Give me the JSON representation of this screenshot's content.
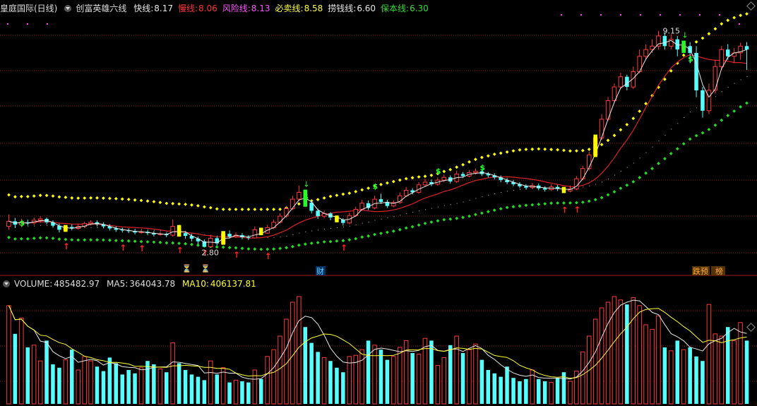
{
  "header": {
    "stock": "皇庭国际(日线)",
    "indicator_name": "创富英雄六线",
    "lines": [
      {
        "label": "快线:",
        "value": "8.17",
        "color": "#e8e8e8"
      },
      {
        "label": "慢线:",
        "value": "8.06",
        "color": "#ff3333"
      },
      {
        "label": "风险线:",
        "value": "8.13",
        "color": "#ff55ff"
      },
      {
        "label": "必卖线:",
        "value": "8.58",
        "color": "#ffff33"
      },
      {
        "label": "捞钱线:",
        "value": "6.60",
        "color": "#e8e8e8"
      },
      {
        "label": "保本线:",
        "value": "6.30",
        "color": "#33dd33"
      }
    ]
  },
  "volume_header": {
    "name": "VOLUME:",
    "value": "485482.97",
    "ma5_label": "MA5:",
    "ma5_value": "364043.78",
    "ma10_label": "MA10:",
    "ma10_value": "406137.81"
  },
  "annotations": {
    "high_label": "9.15",
    "low_label": "2.80",
    "cai_badge": "财",
    "tag1": "跌预",
    "tag2": "榜"
  },
  "colors": {
    "up": "#ff3a3a",
    "down": "#55ffff",
    "fast": "#e8e8e8",
    "slow": "#dd2222",
    "must_sell": "#ffff00",
    "keep": "#22dd22",
    "grid": "#8a1a1a",
    "ma5": "#e8e8e8",
    "ma10": "#ffff33",
    "signal_buy": "#ffff00",
    "signal_green": "#22ff22"
  },
  "chart_data": {
    "type": "candlestick",
    "price_range": [
      2.0,
      9.6
    ],
    "candles": [
      [
        3.4,
        3.55,
        3.75,
        3.3
      ],
      [
        3.55,
        3.45,
        3.65,
        3.35
      ],
      [
        3.45,
        3.52,
        3.62,
        3.38
      ],
      [
        3.52,
        3.5,
        3.6,
        3.42
      ],
      [
        3.5,
        3.58,
        3.66,
        3.44
      ],
      [
        3.58,
        3.62,
        3.7,
        3.5
      ],
      [
        3.62,
        3.52,
        3.66,
        3.46
      ],
      [
        3.52,
        3.42,
        3.58,
        3.36
      ],
      [
        3.42,
        3.3,
        3.48,
        3.22
      ],
      [
        3.3,
        3.38,
        3.44,
        3.24
      ],
      [
        3.38,
        3.34,
        3.46,
        3.28
      ],
      [
        3.34,
        3.4,
        3.48,
        3.3
      ],
      [
        3.4,
        3.48,
        3.54,
        3.36
      ],
      [
        3.48,
        3.52,
        3.58,
        3.42
      ],
      [
        3.52,
        3.46,
        3.58,
        3.4
      ],
      [
        3.46,
        3.4,
        3.52,
        3.34
      ],
      [
        3.4,
        3.34,
        3.46,
        3.28
      ],
      [
        3.34,
        3.3,
        3.4,
        3.24
      ],
      [
        3.3,
        3.28,
        3.36,
        3.22
      ],
      [
        3.28,
        3.26,
        3.34,
        3.2
      ],
      [
        3.26,
        3.22,
        3.32,
        3.16
      ],
      [
        3.22,
        3.24,
        3.3,
        3.18
      ],
      [
        3.24,
        3.2,
        3.28,
        3.14
      ],
      [
        3.2,
        3.16,
        3.26,
        3.1
      ],
      [
        3.16,
        3.18,
        3.24,
        3.12
      ],
      [
        3.18,
        3.14,
        3.22,
        3.08
      ],
      [
        3.14,
        3.4,
        3.6,
        3.1
      ],
      [
        3.4,
        3.2,
        3.44,
        3.1
      ],
      [
        3.2,
        3.12,
        3.26,
        3.04
      ],
      [
        3.12,
        3.04,
        3.18,
        2.96
      ],
      [
        3.04,
        2.96,
        3.1,
        2.88
      ],
      [
        2.96,
        2.8,
        3.02,
        2.8
      ],
      [
        2.8,
        3.05,
        3.15,
        2.8
      ],
      [
        3.05,
        2.9,
        3.1,
        2.84
      ],
      [
        2.9,
        3.18,
        3.26,
        2.86
      ],
      [
        3.18,
        3.1,
        3.28,
        3.04
      ],
      [
        3.1,
        3.14,
        3.22,
        3.06
      ],
      [
        3.14,
        3.08,
        3.2,
        3.02
      ],
      [
        3.08,
        3.06,
        3.14,
        3.0
      ],
      [
        3.06,
        3.3,
        3.4,
        3.04
      ],
      [
        3.3,
        3.2,
        3.36,
        3.14
      ],
      [
        3.2,
        3.36,
        3.44,
        3.18
      ],
      [
        3.36,
        3.52,
        3.6,
        3.32
      ],
      [
        3.52,
        3.7,
        3.78,
        3.48
      ],
      [
        3.7,
        3.92,
        4.0,
        3.66
      ],
      [
        3.92,
        4.2,
        4.3,
        3.88
      ],
      [
        4.2,
        4.4,
        4.6,
        4.14
      ],
      [
        4.4,
        4.1,
        4.48,
        3.98
      ],
      [
        4.1,
        3.86,
        4.16,
        3.78
      ],
      [
        3.86,
        3.7,
        3.92,
        3.62
      ],
      [
        3.7,
        3.78,
        3.86,
        3.64
      ],
      [
        3.78,
        3.66,
        3.82,
        3.58
      ],
      [
        3.66,
        3.6,
        3.72,
        3.52
      ],
      [
        3.6,
        3.5,
        3.64,
        3.42
      ],
      [
        3.5,
        3.72,
        3.8,
        3.46
      ],
      [
        3.72,
        3.9,
        3.98,
        3.68
      ],
      [
        3.9,
        4.08,
        4.18,
        3.86
      ],
      [
        4.08,
        3.94,
        4.16,
        3.88
      ],
      [
        3.94,
        4.2,
        4.3,
        3.9
      ],
      [
        4.2,
        4.12,
        4.36,
        4.06
      ],
      [
        4.12,
        4.0,
        4.18,
        3.94
      ],
      [
        4.0,
        4.1,
        4.16,
        3.96
      ],
      [
        4.1,
        4.3,
        4.4,
        4.06
      ],
      [
        4.3,
        4.46,
        4.56,
        4.26
      ],
      [
        4.46,
        4.4,
        4.52,
        4.34
      ],
      [
        4.4,
        4.62,
        4.7,
        4.36
      ],
      [
        4.62,
        4.7,
        4.8,
        4.56
      ],
      [
        4.7,
        4.64,
        4.78,
        4.58
      ],
      [
        4.64,
        4.76,
        4.84,
        4.6
      ],
      [
        4.76,
        4.84,
        4.92,
        4.7
      ],
      [
        4.84,
        4.72,
        4.9,
        4.66
      ],
      [
        4.72,
        4.94,
        5.04,
        4.68
      ],
      [
        4.94,
        4.88,
        5.0,
        4.82
      ],
      [
        4.88,
        4.98,
        5.06,
        4.84
      ],
      [
        4.98,
        5.02,
        5.1,
        4.92
      ],
      [
        5.02,
        4.94,
        5.08,
        4.88
      ],
      [
        4.94,
        4.9,
        5.0,
        4.84
      ],
      [
        4.9,
        4.84,
        4.96,
        4.78
      ],
      [
        4.84,
        4.76,
        4.9,
        4.7
      ],
      [
        4.76,
        4.7,
        4.82,
        4.64
      ],
      [
        4.7,
        4.64,
        4.76,
        4.58
      ],
      [
        4.64,
        4.58,
        4.7,
        4.52
      ],
      [
        4.58,
        4.54,
        4.64,
        4.48
      ],
      [
        4.54,
        4.6,
        4.68,
        4.5
      ],
      [
        4.6,
        4.52,
        4.66,
        4.46
      ],
      [
        4.52,
        4.48,
        4.58,
        4.42
      ],
      [
        4.48,
        4.56,
        4.64,
        4.44
      ],
      [
        4.56,
        4.5,
        4.62,
        4.44
      ],
      [
        4.5,
        4.44,
        4.56,
        4.38
      ],
      [
        4.44,
        4.5,
        4.6,
        4.4
      ],
      [
        4.5,
        4.8,
        4.88,
        4.46
      ],
      [
        4.8,
        5.1,
        5.18,
        4.76
      ],
      [
        5.1,
        5.5,
        5.6,
        5.04
      ],
      [
        5.5,
        6.0,
        6.1,
        5.44
      ],
      [
        6.0,
        6.55,
        6.7,
        5.94
      ],
      [
        6.55,
        7.1,
        7.2,
        6.5
      ],
      [
        7.1,
        7.5,
        7.6,
        7.04
      ],
      [
        7.5,
        7.8,
        7.92,
        7.44
      ],
      [
        7.8,
        7.5,
        7.86,
        7.4
      ],
      [
        7.5,
        7.95,
        8.1,
        7.44
      ],
      [
        7.95,
        8.4,
        8.6,
        7.9
      ],
      [
        8.4,
        8.6,
        8.75,
        8.3
      ],
      [
        8.6,
        8.7,
        8.9,
        8.5
      ],
      [
        8.7,
        9.0,
        9.15,
        8.6
      ],
      [
        9.0,
        8.7,
        9.1,
        8.6
      ],
      [
        8.7,
        8.9,
        9.05,
        8.6
      ],
      [
        8.9,
        8.6,
        9.0,
        8.4
      ],
      [
        8.6,
        8.7,
        8.86,
        8.5
      ],
      [
        8.7,
        8.5,
        8.82,
        8.2
      ],
      [
        8.5,
        7.4,
        8.7,
        7.2
      ],
      [
        7.4,
        6.8,
        7.5,
        6.6
      ],
      [
        6.8,
        7.4,
        7.6,
        6.7
      ],
      [
        7.4,
        8.1,
        8.3,
        7.3
      ],
      [
        8.1,
        8.6,
        8.7,
        8.0
      ],
      [
        8.6,
        8.4,
        8.76,
        8.3
      ],
      [
        8.4,
        8.5,
        8.64,
        8.2
      ],
      [
        8.5,
        8.7,
        8.8,
        8.3
      ],
      [
        8.7,
        8.6,
        8.82,
        8.0
      ]
    ],
    "volume_range": [
      0,
      1000000
    ],
    "volumes": [
      870,
      620,
      760,
      500,
      520,
      380,
      560,
      350,
      320,
      390,
      480,
      300,
      420,
      380,
      330,
      290,
      410,
      360,
      260,
      300,
      270,
      320,
      380,
      350,
      310,
      280,
      540,
      360,
      300,
      260,
      240,
      210,
      380,
      260,
      320,
      190,
      210,
      200,
      190,
      300,
      220,
      420,
      480,
      600,
      750,
      900,
      950,
      680,
      540,
      460,
      410,
      380,
      320,
      280,
      420,
      430,
      480,
      560,
      520,
      480,
      390,
      420,
      500,
      560,
      450,
      440,
      580,
      560,
      340,
      410,
      520,
      600,
      450,
      480,
      530,
      390,
      300,
      270,
      240,
      330,
      230,
      200,
      220,
      300,
      220,
      200,
      190,
      230,
      280,
      200,
      290,
      460,
      600,
      750,
      850,
      900,
      950,
      920,
      880,
      940,
      870,
      700,
      660,
      780,
      500,
      470,
      560,
      480,
      500,
      420,
      380,
      880,
      620,
      600,
      680,
      560,
      720,
      560
    ],
    "lines": {
      "must_sell_y_start": 3.9,
      "keep_y_start": 2.95,
      "ma5_desc": "5-period moving average of volume",
      "ma10_desc": "10-period moving average of volume"
    }
  }
}
